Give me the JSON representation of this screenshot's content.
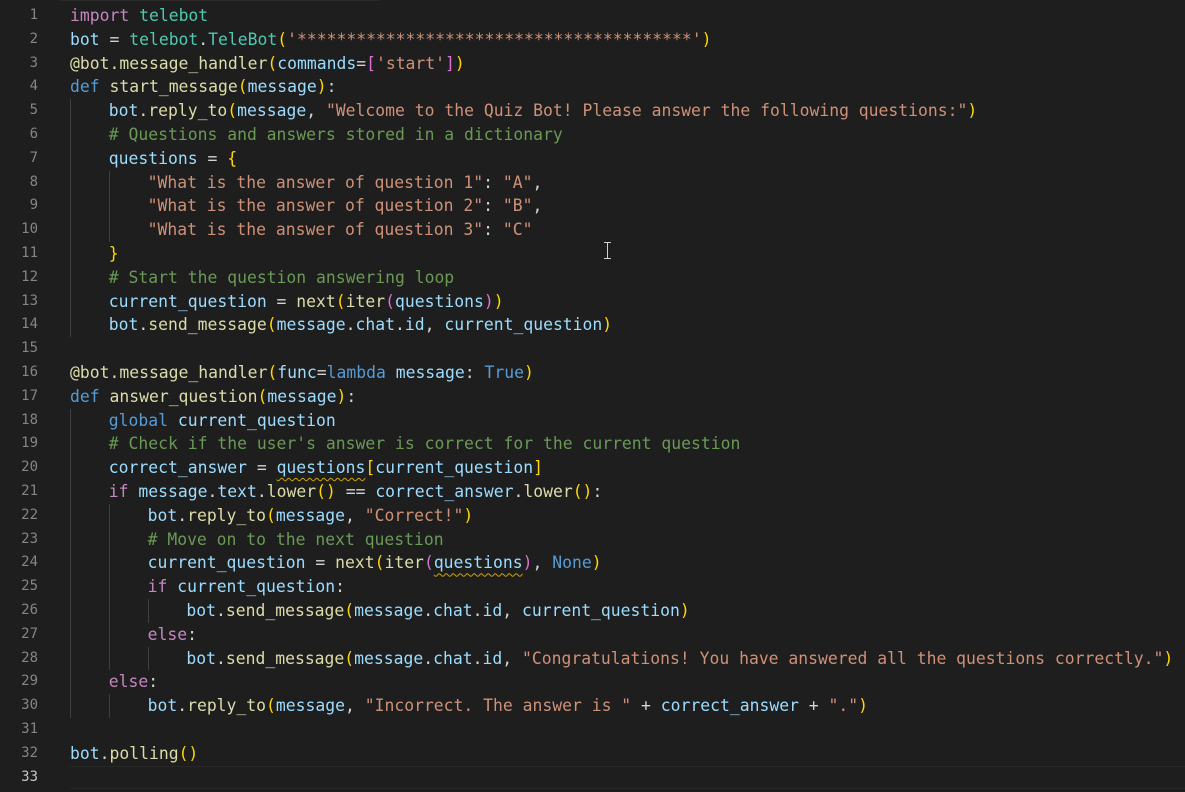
{
  "editor": {
    "language": "python",
    "theme": "dark",
    "active_line": 33,
    "lines": [
      {
        "n": 1,
        "indent": 0,
        "tokens": [
          [
            "ctl",
            "import"
          ],
          [
            "op",
            " "
          ],
          [
            "cls",
            "telebot"
          ]
        ]
      },
      {
        "n": 2,
        "indent": 0,
        "tokens": [
          [
            "var",
            "bot"
          ],
          [
            "op",
            " = "
          ],
          [
            "cls",
            "telebot"
          ],
          [
            "op",
            "."
          ],
          [
            "cls",
            "TeleBot"
          ],
          [
            "b1",
            "("
          ],
          [
            "str",
            "'****************************************'"
          ],
          [
            "b1",
            ")"
          ]
        ]
      },
      {
        "n": 3,
        "indent": 0,
        "tokens": [
          [
            "fn",
            "@bot.message_handler"
          ],
          [
            "b1",
            "("
          ],
          [
            "var",
            "commands"
          ],
          [
            "op",
            "="
          ],
          [
            "b2",
            "["
          ],
          [
            "str",
            "'start'"
          ],
          [
            "b2",
            "]"
          ],
          [
            "b1",
            ")"
          ]
        ]
      },
      {
        "n": 4,
        "indent": 0,
        "tokens": [
          [
            "kw",
            "def"
          ],
          [
            "op",
            " "
          ],
          [
            "fn",
            "start_message"
          ],
          [
            "b1",
            "("
          ],
          [
            "var",
            "message"
          ],
          [
            "b1",
            ")"
          ],
          [
            "op",
            ":"
          ]
        ]
      },
      {
        "n": 5,
        "indent": 1,
        "tokens": [
          [
            "var",
            "bot"
          ],
          [
            "op",
            "."
          ],
          [
            "fn",
            "reply_to"
          ],
          [
            "b1",
            "("
          ],
          [
            "var",
            "message"
          ],
          [
            "op",
            ", "
          ],
          [
            "str",
            "\"Welcome to the Quiz Bot! Please answer the following questions:\""
          ],
          [
            "b1",
            ")"
          ]
        ]
      },
      {
        "n": 6,
        "indent": 1,
        "tokens": [
          [
            "cmt",
            "# Questions and answers stored in a dictionary"
          ]
        ]
      },
      {
        "n": 7,
        "indent": 1,
        "tokens": [
          [
            "var",
            "questions"
          ],
          [
            "op",
            " = "
          ],
          [
            "b1",
            "{"
          ]
        ]
      },
      {
        "n": 8,
        "indent": 2,
        "tokens": [
          [
            "str",
            "\"What is the answer of question 1\""
          ],
          [
            "op",
            ": "
          ],
          [
            "str",
            "\"A\""
          ],
          [
            "op",
            ","
          ]
        ]
      },
      {
        "n": 9,
        "indent": 2,
        "tokens": [
          [
            "str",
            "\"What is the answer of question 2\""
          ],
          [
            "op",
            ": "
          ],
          [
            "str",
            "\"B\""
          ],
          [
            "op",
            ","
          ]
        ]
      },
      {
        "n": 10,
        "indent": 2,
        "tokens": [
          [
            "str",
            "\"What is the answer of question 3\""
          ],
          [
            "op",
            ": "
          ],
          [
            "str",
            "\"C\""
          ]
        ]
      },
      {
        "n": 11,
        "indent": 1,
        "tokens": [
          [
            "b1",
            "}"
          ]
        ]
      },
      {
        "n": 12,
        "indent": 1,
        "tokens": [
          [
            "cmt",
            "# Start the question answering loop"
          ]
        ]
      },
      {
        "n": 13,
        "indent": 1,
        "tokens": [
          [
            "var",
            "current_question"
          ],
          [
            "op",
            " = "
          ],
          [
            "fn",
            "next"
          ],
          [
            "b1",
            "("
          ],
          [
            "fn",
            "iter"
          ],
          [
            "b2",
            "("
          ],
          [
            "var",
            "questions"
          ],
          [
            "b2",
            ")"
          ],
          [
            "b1",
            ")"
          ]
        ]
      },
      {
        "n": 14,
        "indent": 1,
        "tokens": [
          [
            "var",
            "bot"
          ],
          [
            "op",
            "."
          ],
          [
            "fn",
            "send_message"
          ],
          [
            "b1",
            "("
          ],
          [
            "var",
            "message"
          ],
          [
            "op",
            "."
          ],
          [
            "var",
            "chat"
          ],
          [
            "op",
            "."
          ],
          [
            "var",
            "id"
          ],
          [
            "op",
            ", "
          ],
          [
            "var",
            "current_question"
          ],
          [
            "b1",
            ")"
          ]
        ]
      },
      {
        "n": 15,
        "indent": 0,
        "tokens": []
      },
      {
        "n": 16,
        "indent": 0,
        "tokens": [
          [
            "fn",
            "@bot.message_handler"
          ],
          [
            "b1",
            "("
          ],
          [
            "var",
            "func"
          ],
          [
            "op",
            "="
          ],
          [
            "kw",
            "lambda"
          ],
          [
            "op",
            " "
          ],
          [
            "var",
            "message"
          ],
          [
            "op",
            ": "
          ],
          [
            "kw",
            "True"
          ],
          [
            "b1",
            ")"
          ]
        ]
      },
      {
        "n": 17,
        "indent": 0,
        "tokens": [
          [
            "kw",
            "def"
          ],
          [
            "op",
            " "
          ],
          [
            "fn",
            "answer_question"
          ],
          [
            "b1",
            "("
          ],
          [
            "var",
            "message"
          ],
          [
            "b1",
            ")"
          ],
          [
            "op",
            ":"
          ]
        ]
      },
      {
        "n": 18,
        "indent": 1,
        "tokens": [
          [
            "kw",
            "global"
          ],
          [
            "op",
            " "
          ],
          [
            "var",
            "current_question"
          ]
        ]
      },
      {
        "n": 19,
        "indent": 1,
        "tokens": [
          [
            "cmt",
            "# Check if the user's answer is correct for the current question"
          ]
        ]
      },
      {
        "n": 20,
        "indent": 1,
        "tokens": [
          [
            "var",
            "correct_answer"
          ],
          [
            "op",
            " = "
          ],
          [
            "var squig",
            "questions"
          ],
          [
            "b1",
            "["
          ],
          [
            "var",
            "current_question"
          ],
          [
            "b1",
            "]"
          ]
        ]
      },
      {
        "n": 21,
        "indent": 1,
        "tokens": [
          [
            "ctl",
            "if"
          ],
          [
            "op",
            " "
          ],
          [
            "var",
            "message"
          ],
          [
            "op",
            "."
          ],
          [
            "var",
            "text"
          ],
          [
            "op",
            "."
          ],
          [
            "fn",
            "lower"
          ],
          [
            "b1",
            "()"
          ],
          [
            "op",
            " == "
          ],
          [
            "var",
            "correct_answer"
          ],
          [
            "op",
            "."
          ],
          [
            "fn",
            "lower"
          ],
          [
            "b1",
            "()"
          ],
          [
            "op",
            ":"
          ]
        ]
      },
      {
        "n": 22,
        "indent": 2,
        "tokens": [
          [
            "var",
            "bot"
          ],
          [
            "op",
            "."
          ],
          [
            "fn",
            "reply_to"
          ],
          [
            "b1",
            "("
          ],
          [
            "var",
            "message"
          ],
          [
            "op",
            ", "
          ],
          [
            "str",
            "\"Correct!\""
          ],
          [
            "b1",
            ")"
          ]
        ]
      },
      {
        "n": 23,
        "indent": 2,
        "tokens": [
          [
            "cmt",
            "# Move on to the next question"
          ]
        ]
      },
      {
        "n": 24,
        "indent": 2,
        "tokens": [
          [
            "var",
            "current_question"
          ],
          [
            "op",
            " = "
          ],
          [
            "fn",
            "next"
          ],
          [
            "b1",
            "("
          ],
          [
            "fn",
            "iter"
          ],
          [
            "b2",
            "("
          ],
          [
            "var squig",
            "questions"
          ],
          [
            "b2",
            ")"
          ],
          [
            "op",
            ", "
          ],
          [
            "kw",
            "None"
          ],
          [
            "b1",
            ")"
          ]
        ]
      },
      {
        "n": 25,
        "indent": 2,
        "tokens": [
          [
            "ctl",
            "if"
          ],
          [
            "op",
            " "
          ],
          [
            "var",
            "current_question"
          ],
          [
            "op",
            ":"
          ]
        ]
      },
      {
        "n": 26,
        "indent": 3,
        "tokens": [
          [
            "var",
            "bot"
          ],
          [
            "op",
            "."
          ],
          [
            "fn",
            "send_message"
          ],
          [
            "b1",
            "("
          ],
          [
            "var",
            "message"
          ],
          [
            "op",
            "."
          ],
          [
            "var",
            "chat"
          ],
          [
            "op",
            "."
          ],
          [
            "var",
            "id"
          ],
          [
            "op",
            ", "
          ],
          [
            "var",
            "current_question"
          ],
          [
            "b1",
            ")"
          ]
        ]
      },
      {
        "n": 27,
        "indent": 2,
        "tokens": [
          [
            "ctl",
            "else"
          ],
          [
            "op",
            ":"
          ]
        ]
      },
      {
        "n": 28,
        "indent": 3,
        "tokens": [
          [
            "var",
            "bot"
          ],
          [
            "op",
            "."
          ],
          [
            "fn",
            "send_message"
          ],
          [
            "b1",
            "("
          ],
          [
            "var",
            "message"
          ],
          [
            "op",
            "."
          ],
          [
            "var",
            "chat"
          ],
          [
            "op",
            "."
          ],
          [
            "var",
            "id"
          ],
          [
            "op",
            ", "
          ],
          [
            "str",
            "\"Congratulations! You have answered all the questions correctly.\""
          ],
          [
            "b1",
            ")"
          ]
        ]
      },
      {
        "n": 29,
        "indent": 1,
        "tokens": [
          [
            "ctl",
            "else"
          ],
          [
            "op",
            ":"
          ]
        ]
      },
      {
        "n": 30,
        "indent": 2,
        "tokens": [
          [
            "var",
            "bot"
          ],
          [
            "op",
            "."
          ],
          [
            "fn",
            "reply_to"
          ],
          [
            "b1",
            "("
          ],
          [
            "var",
            "message"
          ],
          [
            "op",
            ", "
          ],
          [
            "str",
            "\"Incorrect. The answer is \""
          ],
          [
            "op",
            " + "
          ],
          [
            "var",
            "correct_answer"
          ],
          [
            "op",
            " + "
          ],
          [
            "str",
            "\".\""
          ],
          [
            "b1",
            ")"
          ]
        ]
      },
      {
        "n": 31,
        "indent": 0,
        "tokens": []
      },
      {
        "n": 32,
        "indent": 0,
        "tokens": [
          [
            "var",
            "bot"
          ],
          [
            "op",
            "."
          ],
          [
            "fn",
            "polling"
          ],
          [
            "b1",
            "()"
          ]
        ]
      },
      {
        "n": 33,
        "indent": 0,
        "tokens": []
      }
    ]
  }
}
